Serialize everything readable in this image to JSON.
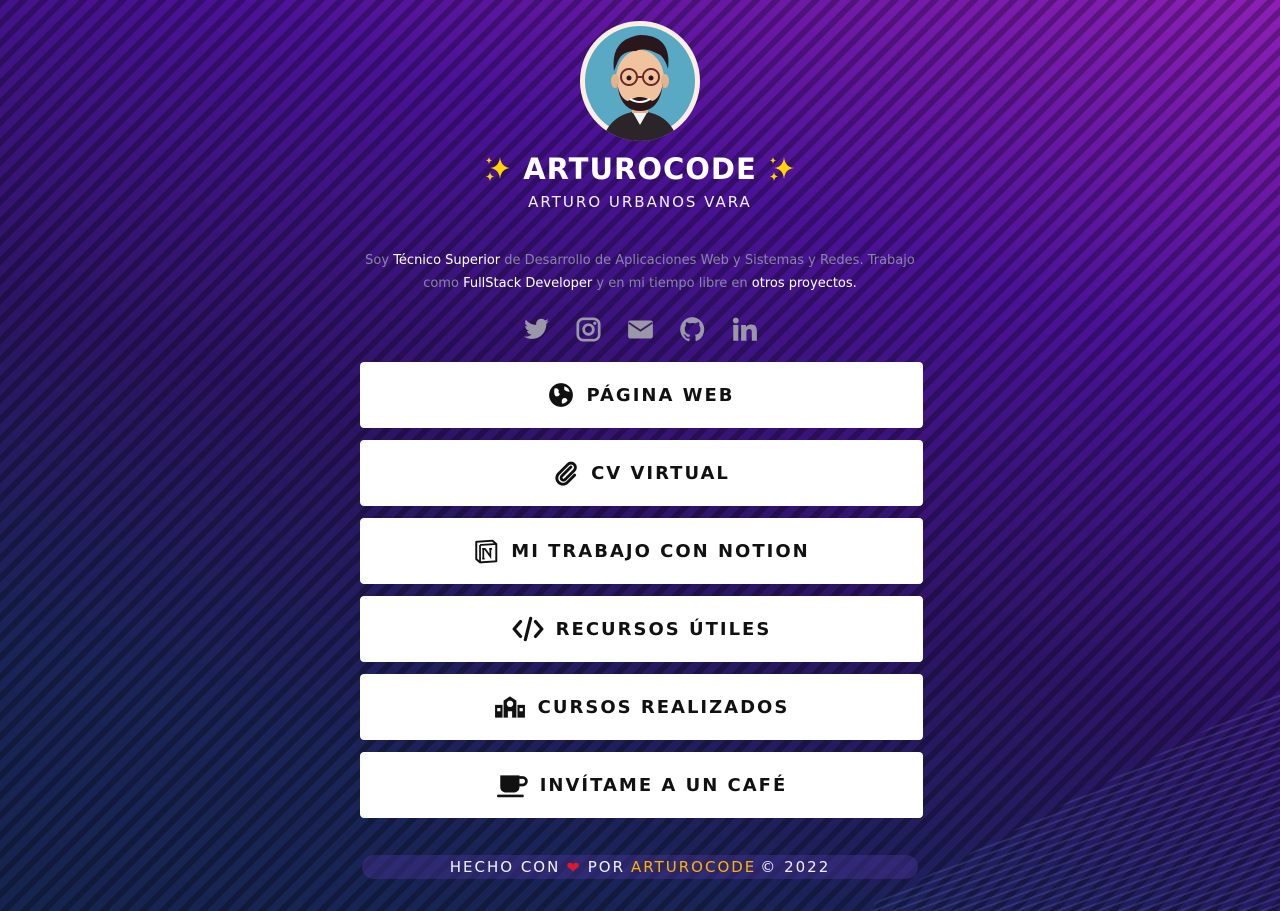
{
  "profile": {
    "title": "ARTUROCODE",
    "subtitle": "ARTURO URBANOS VARA",
    "avatar_icon": "cartoon-avatar"
  },
  "bio": {
    "part1": "Soy ",
    "highlight1": "Técnico Superior",
    "part2": " de Desarrollo de Aplicaciones Web y Sistemas y Redes. Trabajo como ",
    "highlight2": "FullStack Developer",
    "part3": " y en mi tiempo libre en ",
    "highlight3": "otros proyectos."
  },
  "socials": [
    {
      "icon": "twitter-icon"
    },
    {
      "icon": "instagram-icon"
    },
    {
      "icon": "envelope-icon"
    },
    {
      "icon": "github-icon"
    },
    {
      "icon": "linkedin-icon"
    }
  ],
  "links": [
    {
      "label": "PÁGINA WEB",
      "icon": "globe-icon"
    },
    {
      "label": "CV VIRTUAL",
      "icon": "paperclip-icon"
    },
    {
      "label": "MI TRABAJO CON NOTION",
      "icon": "notion-icon"
    },
    {
      "label": "RECURSOS ÚTILES",
      "icon": "code-icon"
    },
    {
      "label": "CURSOS REALIZADOS",
      "icon": "school-icon"
    },
    {
      "label": "INVÍTAME A UN CAFÉ",
      "icon": "coffee-icon"
    }
  ],
  "footer": {
    "made_with": "HECHO CON",
    "by": "POR",
    "brand": "ARTUROCODE",
    "copyright": "© 2022"
  },
  "colors": {
    "accent": "#ffb300",
    "heart": "#e0162b",
    "button_bg": "#ffffff",
    "icon_grey": "#9a97a8"
  }
}
